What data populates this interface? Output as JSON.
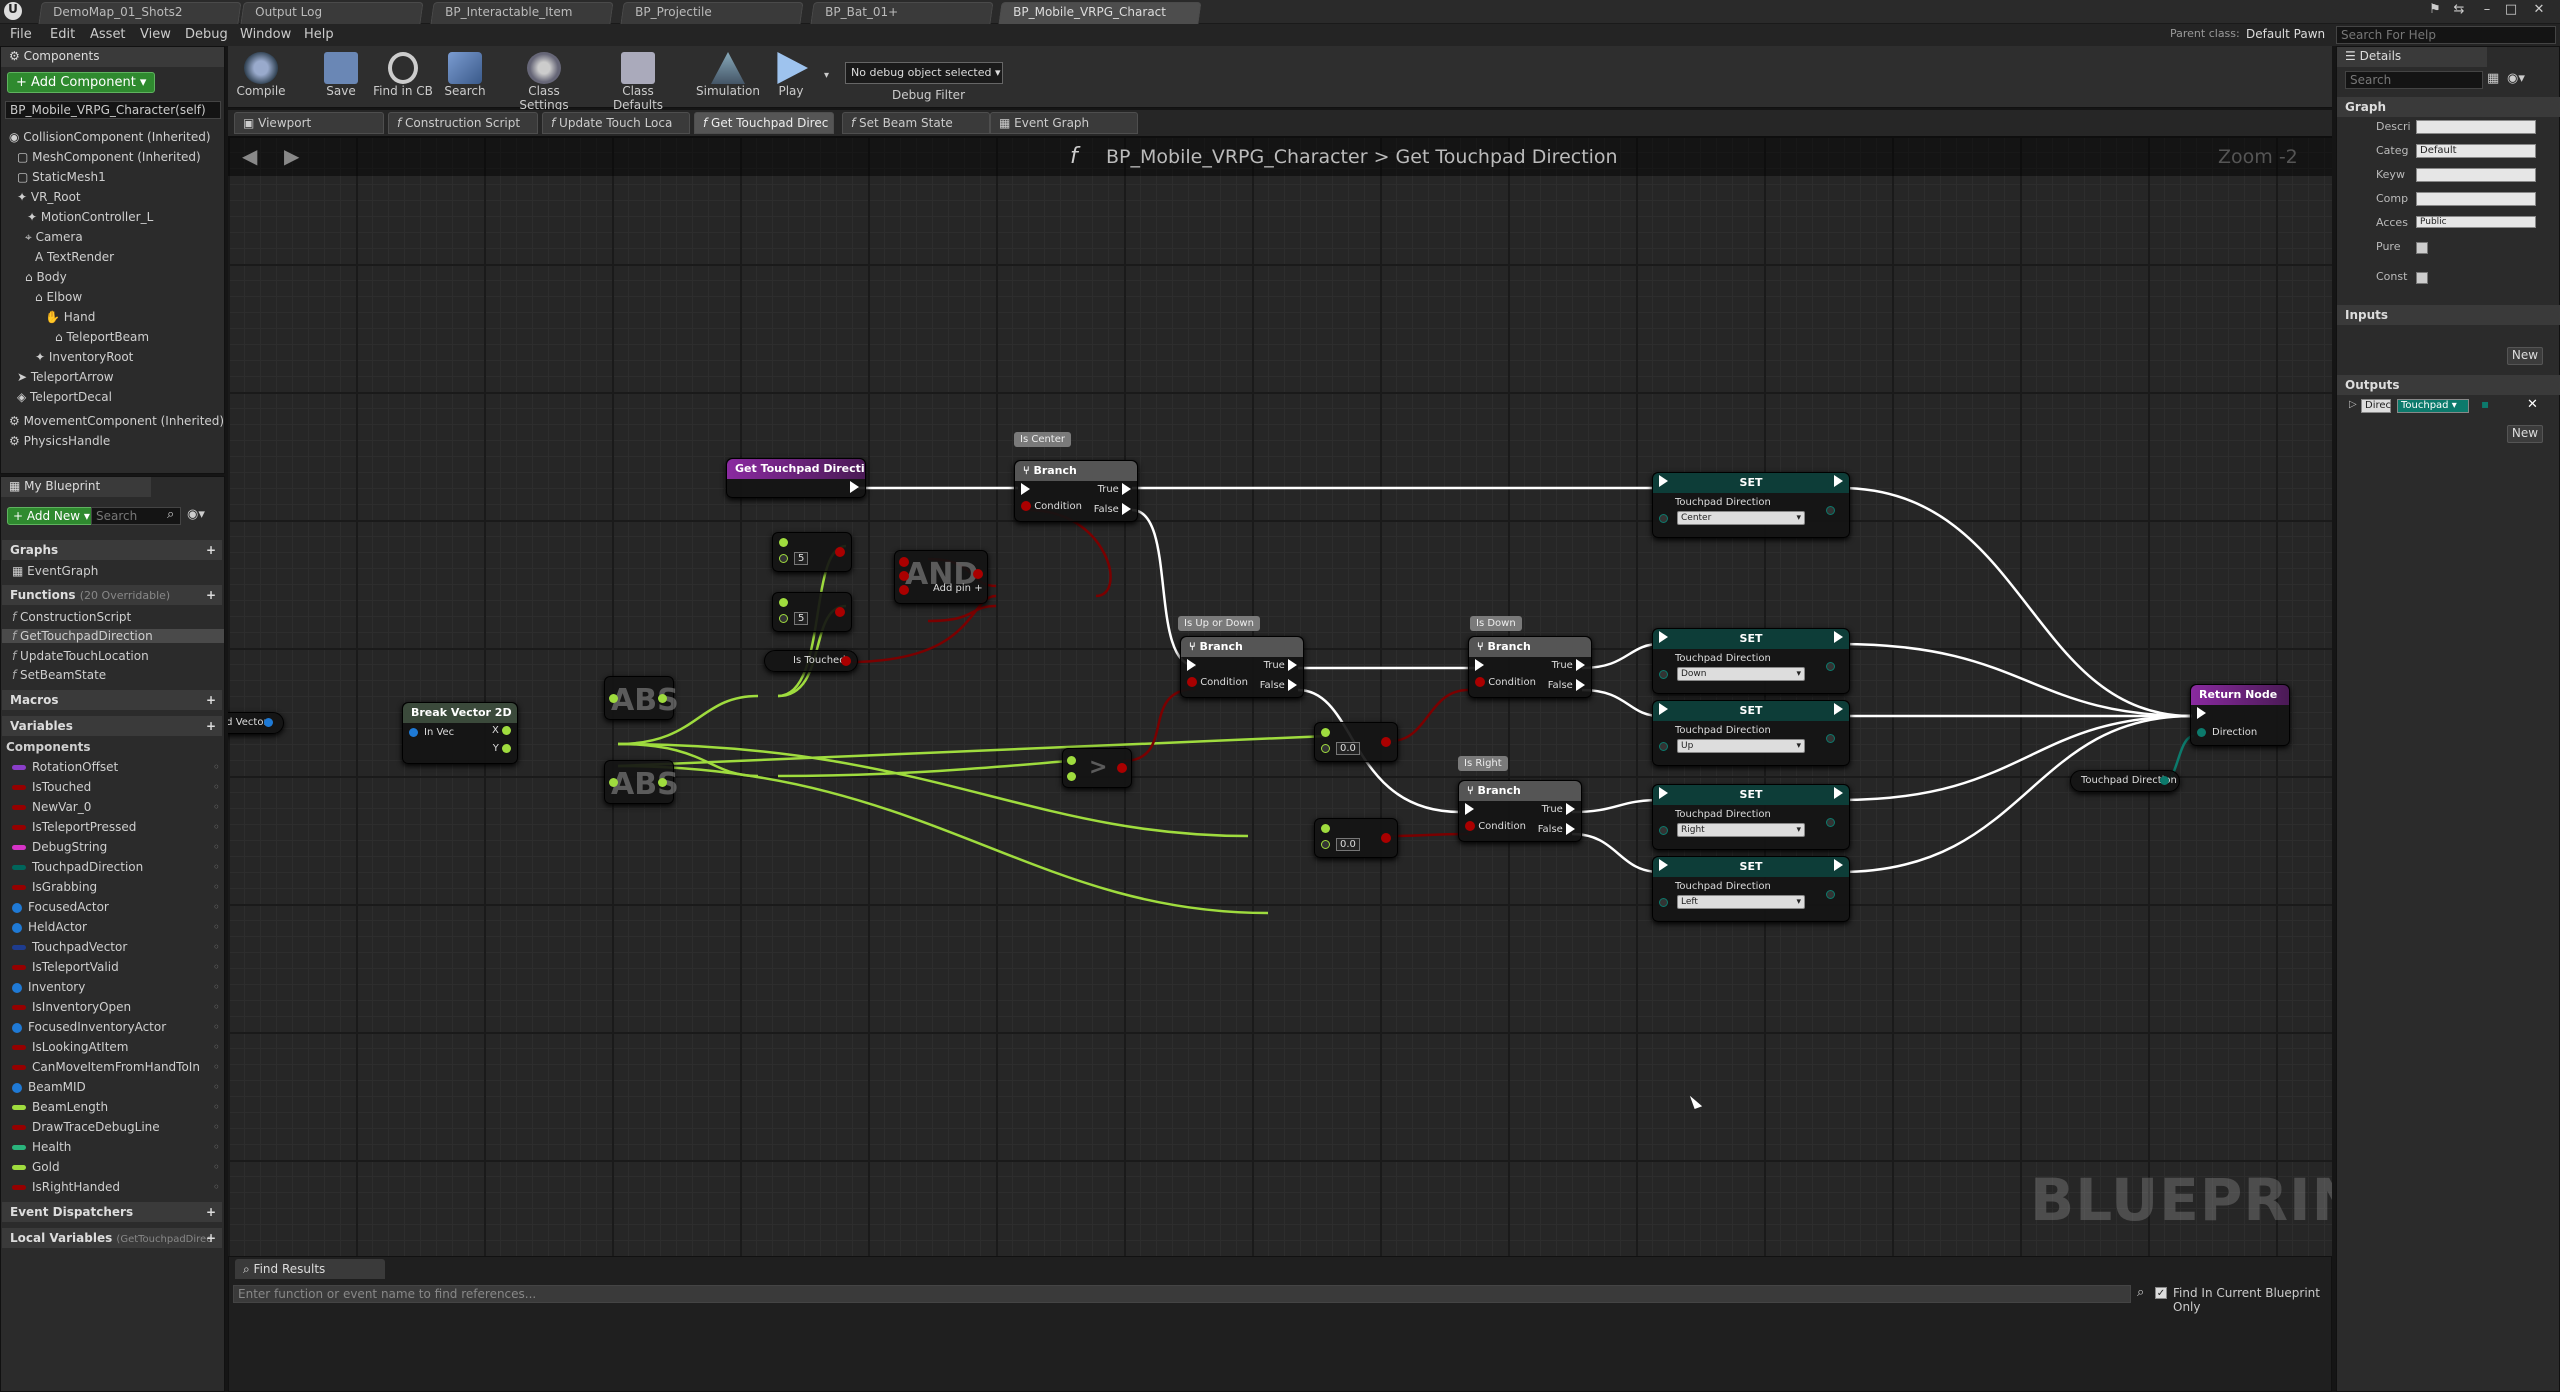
{
  "titlebar": {
    "tabs": [
      "DemoMap_01_Shots2",
      "Output Log",
      "BP_Interactable_Item",
      "BP_Projectile",
      "BP_Bat_01+",
      "BP_Mobile_VRPG_Charact"
    ]
  },
  "menubar": {
    "items": [
      "File",
      "Edit",
      "Asset",
      "View",
      "Debug",
      "Window",
      "Help"
    ],
    "parent_class_label": "Parent class:",
    "parent_class_value": "Default Pawn",
    "search_help_placeholder": "Search For Help"
  },
  "components_panel": {
    "title": "Components",
    "add_button": "+ Add Component ▾",
    "root": "BP_Mobile_VRPG_Character(self)",
    "tree": [
      "CollisionComponent (Inherited)",
      "MeshComponent (Inherited)",
      "StaticMesh1",
      "VR_Root",
      "MotionController_L",
      "Camera",
      "TextRender",
      "Body",
      "Elbow",
      "Hand",
      "TeleportBeam",
      "InventoryRoot",
      "TeleportArrow",
      "TeleportDecal",
      "MovementComponent (Inherited)",
      "PhysicsHandle"
    ]
  },
  "my_blueprint": {
    "title": "My Blueprint",
    "add_new": "+ Add New ▾",
    "search_placeholder": "Search",
    "graphs_label": "Graphs",
    "graphs": [
      "EventGraph"
    ],
    "functions_label": "Functions",
    "functions_note": "(20 Overridable)",
    "functions": [
      "ConstructionScript",
      "GetTouchpadDirection",
      "UpdateTouchLocation",
      "SetBeamState"
    ],
    "macros_label": "Macros",
    "variables_label": "Variables",
    "components_label": "Components",
    "variables": [
      {
        "name": "RotationOffset",
        "color": "#8a3ec9"
      },
      {
        "name": "IsTouched",
        "color": "#950000"
      },
      {
        "name": "NewVar_0",
        "color": "#950000"
      },
      {
        "name": "IsTeleportPressed",
        "color": "#950000"
      },
      {
        "name": "DebugString",
        "color": "#d633c7"
      },
      {
        "name": "TouchpadDirection",
        "color": "#00665b"
      },
      {
        "name": "IsGrabbing",
        "color": "#950000"
      },
      {
        "name": "FocusedActor",
        "color": "#1f7ad6"
      },
      {
        "name": "HeldActor",
        "color": "#1f7ad6"
      },
      {
        "name": "TouchpadVector",
        "color": "#1e3c8f"
      },
      {
        "name": "IsTeleportValid",
        "color": "#950000"
      },
      {
        "name": "Inventory",
        "color": "#1f7ad6"
      },
      {
        "name": "IsInventoryOpen",
        "color": "#950000"
      },
      {
        "name": "FocusedInventoryActor",
        "color": "#1f7ad6"
      },
      {
        "name": "IsLookingAtItem",
        "color": "#950000"
      },
      {
        "name": "CanMoveItemFromHandToIn",
        "color": "#950000"
      },
      {
        "name": "BeamMID",
        "color": "#1f7ad6"
      },
      {
        "name": "BeamLength",
        "color": "#9fdc3e"
      },
      {
        "name": "DrawTraceDebugLine",
        "color": "#950000"
      },
      {
        "name": "Health",
        "color": "#2ab47c"
      },
      {
        "name": "Gold",
        "color": "#9fdc3e"
      },
      {
        "name": "IsRightHanded",
        "color": "#950000"
      }
    ],
    "event_dispatchers_label": "Event Dispatchers",
    "local_variables_label": "Local Variables",
    "local_variables_note": "(GetTouchpadDirec"
  },
  "toolbar": {
    "items": [
      "Compile",
      "Save",
      "Find in CB",
      "Search",
      "Class Settings",
      "Class Defaults",
      "Simulation",
      "Play"
    ],
    "debug_select": "No debug object selected ▾",
    "debug_filter": "Debug Filter"
  },
  "graph_tabs": [
    "Viewport",
    "Construction Script",
    "Update Touch Loca",
    "Get Touchpad Direc",
    "Set Beam State",
    "Event Graph"
  ],
  "graph": {
    "breadcrumb_class": "BP_Mobile_VRPG_Character",
    "breadcrumb_sep": ">",
    "breadcrumb_function": "Get Touchpad Direction",
    "zoom": "Zoom -2",
    "watermark": "BLUEPRINT",
    "comments": [
      "Is Center",
      "Is Up or Down",
      "Is Down",
      "Is Right"
    ],
    "nodes": {
      "entry": "Get Touchpad Direction",
      "branch": "Branch",
      "true": "True",
      "false": "False",
      "condition": "Condition",
      "set": "SET",
      "touchpad_direction": "Touchpad Direction",
      "break_vector": "Break Vector 2D",
      "in_vec": "In Vec",
      "x": "X",
      "y": "Y",
      "touchpad_vector": "Touchpad Vector",
      "abs": "ABS",
      "and": "AND",
      "add_pin": "Add pin",
      "is_touched": "Is Touched",
      "return": "Return Node",
      "direction": "Direction",
      "touchpad_dir_getter": "Touchpad Direction",
      "val_5a": "5",
      "val_5b": "5",
      "val_0a": "0.0",
      "val_0b": "0.0"
    },
    "set_values": [
      "Center",
      "Down",
      "Up",
      "Right",
      "Left"
    ]
  },
  "find_results": {
    "title": "Find Results",
    "placeholder": "Enter function or event name to find references...",
    "checkbox_label": "Find In Current Blueprint Only"
  },
  "details": {
    "title": "Details",
    "search_placeholder": "Search",
    "graph_label": "Graph",
    "fields": [
      "Descri",
      "Categ",
      "Keyw",
      "Comp",
      "Acces",
      "Pure",
      "Const"
    ],
    "category_value": "Default",
    "access_value": "Public",
    "inputs_label": "Inputs",
    "outputs_label": "Outputs",
    "new_button": "New",
    "output_name": "Direc",
    "output_type": "Touchpad ▾"
  }
}
